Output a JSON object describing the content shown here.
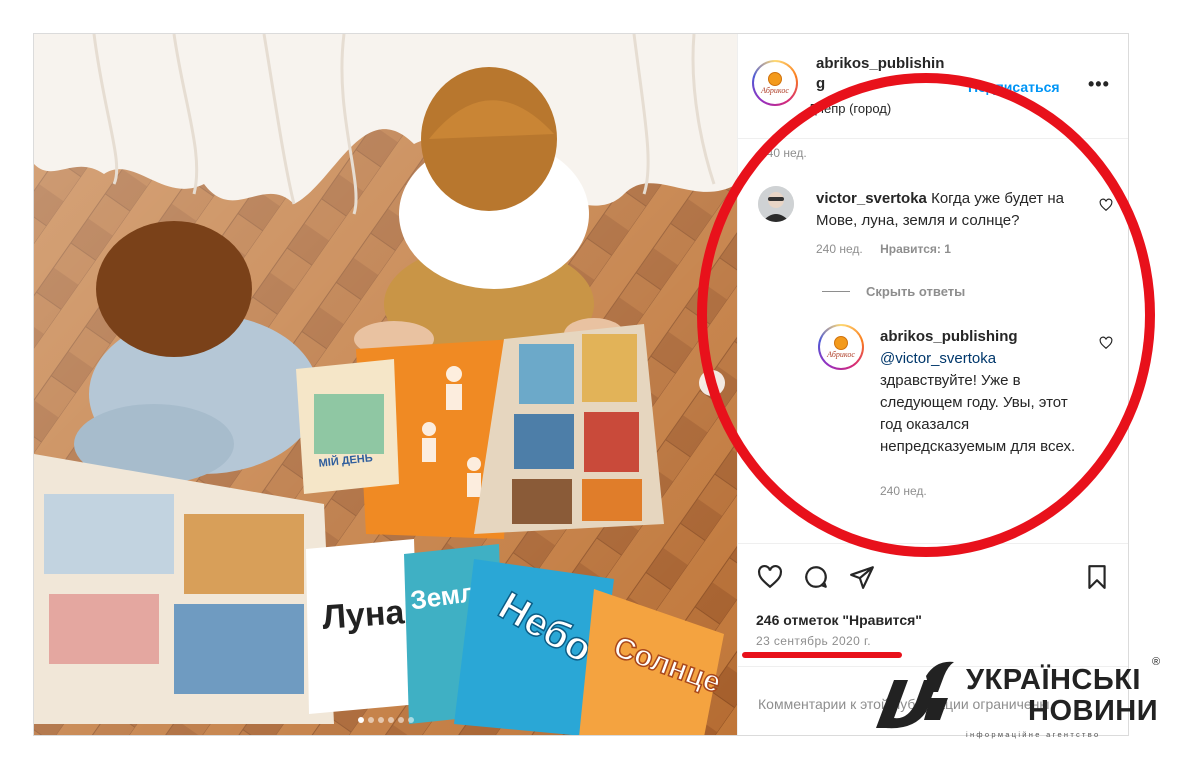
{
  "post": {
    "username_line1": "abrikos_publishin",
    "username_line2": "g",
    "follow_label": "Подписаться",
    "more_label": "•••",
    "location": "Днепр (город)",
    "logo_text": "Абрикос",
    "carousel": {
      "total": 6,
      "active": 1
    },
    "next_label": "›"
  },
  "comments": [
    {
      "timestamp": "240 нед."
    },
    {
      "username": "victor_svertoka",
      "text": "Когда уже будет на Мове, луна, земля и солнце?",
      "timestamp": "240 нед.",
      "likes": "Нравится: 1",
      "hide_replies": "Скрыть ответы",
      "reply": {
        "username": "abrikos_publishing",
        "mention": "@victor_svertoka",
        "text": "здравствуйте! Уже в следующем году. Увы, этот год оказался непредсказуемым для всех.",
        "timestamp": "240 нед."
      }
    }
  ],
  "actions": {
    "likes_count": "246 отметок \"Нравится\"",
    "date": "23 сентябрь 2020 г.",
    "comment_placeholder": "Комментарии к этой публикации ограничены."
  },
  "watermark": {
    "line1": "УКРАЇНСЬКІ",
    "line2": "НОВИНИ",
    "tagline": "інформаційне агентство",
    "reg": "®"
  },
  "books": {
    "my_day": "МІЙ ДЕНЬ",
    "moon": "Луна",
    "earth": "Земля",
    "sky": "Небо",
    "sun": "Солнце"
  },
  "colors": {
    "accent_blue": "#0095f6",
    "annotation_red": "#e8111b",
    "muted": "#8e8e8e",
    "floor": "#b56c32"
  }
}
